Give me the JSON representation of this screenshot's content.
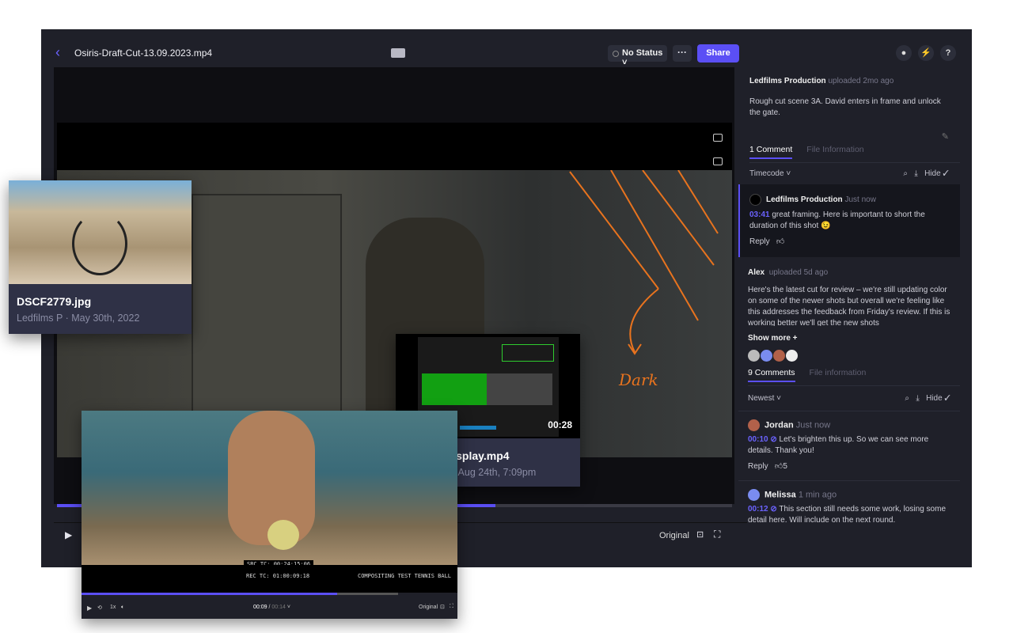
{
  "header": {
    "title": "Osiris-Draft-Cut-13.09.2023.mp4",
    "status": "No Status",
    "more": "···",
    "share": "Share",
    "accent": "#5b4ff5",
    "icons": [
      "back-chevron",
      "device-icon",
      "user-icon",
      "bolt-icon",
      "help-icon"
    ],
    "help": "?"
  },
  "player": {
    "annotation": "Dark",
    "quality": "Original",
    "progress": 0.65
  },
  "sidebar": {
    "upload1": {
      "author": "Ledfilms Production",
      "meta": "uploaded 2mo ago",
      "description": "Rough cut scene 3A. David enters in frame and unlock the gate."
    },
    "tabs1": [
      "1 Comment",
      "File Information"
    ],
    "sort1": "Timecode",
    "hide": "Hide",
    "comment1": {
      "author": "Ledfilms Production",
      "time": "Just now",
      "timecode": "03:41",
      "text": "great framing. Here is important to short the duration of this shot 😉",
      "reply": "Reply"
    },
    "upload2": {
      "author": "Alex",
      "meta": "uploaded 5d ago",
      "description": "Here's the latest cut for review – we're still updating color on some of the newer shots but overall we're feeling like this addresses the feedback from Friday's review. If this is working better we'll get the new shots",
      "show_more": "Show more +"
    },
    "tabs2": [
      "9 Comments",
      "File information"
    ],
    "sort2": "Newest",
    "comment2": {
      "author": "Jordan",
      "time": "Just now",
      "timecode": "00:10",
      "text": "Let's brighten this up. So we can see more details. Thank you!",
      "reply": "Reply",
      "likes": "5"
    },
    "comment3": {
      "author": "Melissa",
      "time": "1 min ago",
      "timecode": "00:12",
      "text": "This section still needs some work, losing some detail here. Will include on the next round."
    }
  },
  "cards": {
    "photo": {
      "name": "DSCF2779.jpg",
      "meta": "Ledfilms P · May 30th, 2022"
    },
    "video": {
      "name": "Energy-Display.mp4",
      "meta": "Ledfilms P · Aug 24th, 7:09pm",
      "duration": "00:28"
    }
  },
  "mini_player": {
    "src_tc": "SRC TC: 00:24:15:06",
    "rec_tc": "REC TC: 01:00:09:18",
    "caption": "COMPOSITING TEST TENNIS BALL",
    "speed": "1x",
    "current": "00:09",
    "total": "00:14",
    "quality": "Original",
    "progress": 0.67,
    "buffered": 0.83
  }
}
